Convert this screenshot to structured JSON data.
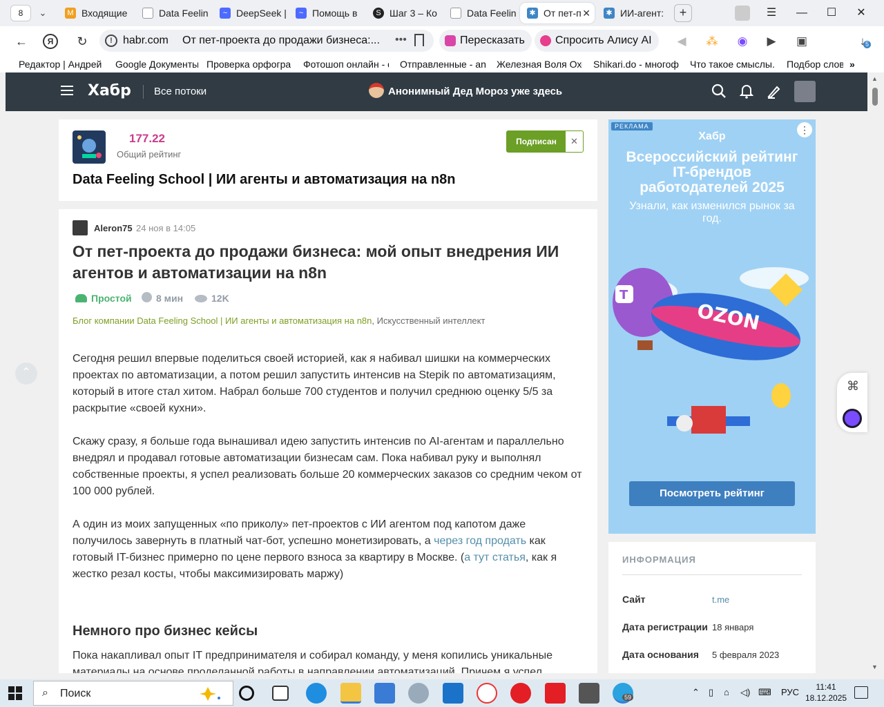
{
  "browser": {
    "tab_count": "8",
    "tabs": [
      {
        "label": "Входящие",
        "icon": "mail-icon",
        "color": "#f0a020"
      },
      {
        "label": "Data Feelin",
        "icon": "doc-icon",
        "color": "#9aa0a6"
      },
      {
        "label": "DeepSeek |",
        "icon": "deepseek-icon",
        "color": "#4d6bfe"
      },
      {
        "label": "Помощь в",
        "icon": "deepseek-icon",
        "color": "#4d6bfe"
      },
      {
        "label": "Шаг 3 – Ко",
        "icon": "stepik-icon",
        "color": "#222222"
      },
      {
        "label": "Data Feelin",
        "icon": "doc-icon",
        "color": "#9aa0a6"
      },
      {
        "label": "От пет-п",
        "icon": "habr-icon",
        "color": "#3e86c6",
        "active": true
      },
      {
        "label": "ИИ-агент:",
        "icon": "habr-icon",
        "color": "#3e86c6"
      }
    ],
    "address": {
      "domain": "habr.com",
      "title": "От пет-проекта до продажи бизнеса:..."
    },
    "pills": {
      "retell": "Пересказать",
      "alice": "Спросить Алису AI"
    },
    "downloads_badge": "5",
    "bookmarks": [
      "Редактор | Андрей Л",
      "Google Документы",
      "Проверка орфограф",
      "Фотошоп онлайн - ф",
      "Отправленные - and",
      "Железная Воля Охот",
      "Shikari.do - многофу",
      "Что такое смыслы. К",
      "Подбор слов"
    ]
  },
  "habr": {
    "logo": "Хабр",
    "flows": "Все потоки",
    "promo": "Анонимный Дед Мороз уже здесь",
    "hub": {
      "rating": "177.22",
      "rating_label": "Общий рейтинг",
      "subscribed": "Подписан",
      "name": "Data Feeling School | ИИ агенты и автоматизация на n8n"
    },
    "article": {
      "author": "Aleron75",
      "date": "24 ноя в 14:05",
      "title": "От пет-проекта до продажи бизнеса: мой опыт внедрения ИИ агентов и автоматизации на n8n",
      "difficulty": "Простой",
      "read_time": "8 мин",
      "views": "12K",
      "hub_link": "Блог компании Data Feeling School | ИИ агенты и автоматизация на n8n",
      "hub_sep": ",",
      "hub_other": "Искусственный интеллект",
      "p1": "Сегодня решил впервые поделиться своей историей, как я набивал шишки на коммерческих проектах по автоматизации, а потом решил запустить интенсив на Stepik по автоматизациям, который в итоге стал хитом. Набрал больше 700 студентов и получил среднюю оценку 5/5 за раскрытие «своей кухни».",
      "p2": "Скажу сразу, я больше года вынашивал идею запустить интенсив по AI-агентам и параллельно внедрял и продавал готовые автоматизации бизнесам сам. Пока набивал руку и выполнял собственные проекты, я успел реализовать больше 20 коммерческих заказов со средним чеком от 100 000 рублей.",
      "p3a": "А один из моих запущенных «по приколу» пет-проектов с ИИ агентом под капотом даже получилось завернуть в платный чат-бот, успешно монетизировать, а",
      "p3link1": "через год продать",
      "p3b": "как готовый IT-бизнес примерно по цене первого взноса за квартиру в Москве. (",
      "p3link2": "а тут статья",
      "p3c": ", как я жестко резал косты, чтобы максимизировать маржу)",
      "h2": "Немного про бизнес кейсы",
      "p4": "Пока накапливал опыт IT предпринимателя и собирал команду, у меня копились уникальные материалы на основе проделанной работы в направлении автоматизаций. Причем я успел"
    },
    "ad": {
      "tag": "РЕКЛАМА",
      "brand": "Хабр",
      "headline": "Всероссийский рейтинг IT-брендов работодателей 2025",
      "sub": "Узнали, как изменился рынок за год.",
      "button": "Посмотреть рейтинг"
    },
    "info": {
      "header": "ИНФОРМАЦИЯ",
      "rows": [
        {
          "label": "Сайт",
          "value": "t.me"
        },
        {
          "label": "Дата регистрации",
          "value": "18 января"
        },
        {
          "label": "Дата основания",
          "value": "5 февраля 2023"
        }
      ]
    }
  },
  "taskbar": {
    "search": "Поиск",
    "lang": "РУС",
    "time": "11:41",
    "date": "18.12.2025",
    "telegram_badge": "59"
  },
  "colors": {
    "habr_header": "#303b44",
    "accent_green": "#6b9f26",
    "rating_pink": "#c93d8c",
    "link": "#548eaa",
    "ad_bg": "#9fd1f4"
  }
}
